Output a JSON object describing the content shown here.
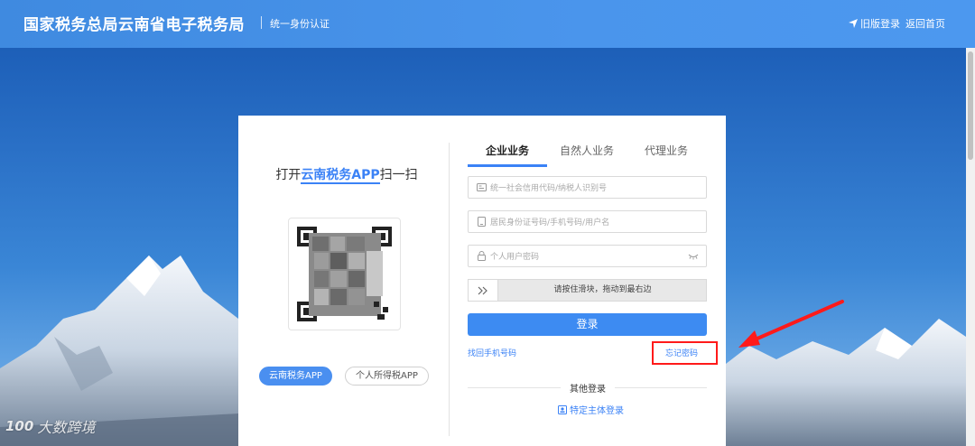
{
  "header": {
    "title": "国家税务总局云南省电子税务局",
    "subtitle": "统一身份认证",
    "old_login": "旧版登录",
    "home": "返回首页"
  },
  "qr_panel": {
    "title_prefix": "打开",
    "title_app": "云南税务APP",
    "title_suffix": "扫一扫",
    "btn_app": "云南税务APP",
    "btn_tax_app": "个人所得税APP"
  },
  "tabs": [
    {
      "label": "企业业务",
      "active": true
    },
    {
      "label": "自然人业务",
      "active": false
    },
    {
      "label": "代理业务",
      "active": false
    }
  ],
  "form": {
    "credit_code_placeholder": "统一社会信用代码/纳税人识别号",
    "id_placeholder": "居民身份证号码/手机号码/用户名",
    "password_placeholder": "个人用户密码",
    "slider_text": "请按住滑块，拖动到最右边",
    "login_button": "登录",
    "retrieve_phone": "找回手机号码",
    "forgot_password": "忘记密码",
    "other_login": "其他登录",
    "special_login": "特定主体登录"
  },
  "watermark": {
    "logo": "100",
    "text": "大数跨境"
  },
  "colors": {
    "accent": "#3d8bf2",
    "header": "#4a95ec",
    "annotation": "#ff1a1a"
  }
}
